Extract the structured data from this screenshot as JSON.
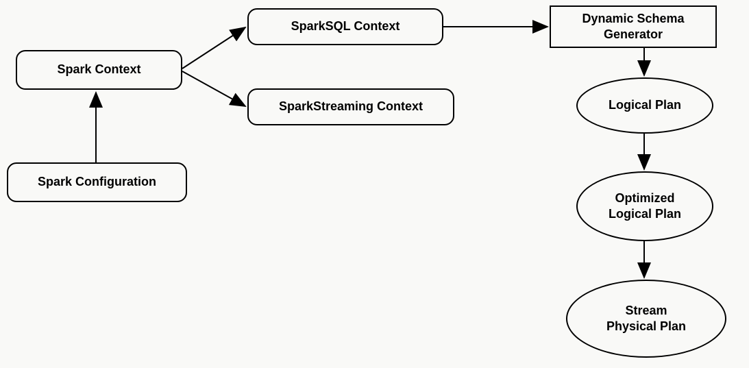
{
  "nodes": {
    "sparkContext": "Spark Context",
    "sparkConfiguration": "Spark Configuration",
    "sparksqlContext": "SparkSQL Context",
    "sparkstreamingContext": "SparkStreaming Context",
    "dynamicSchemaGenerator": "Dynamic Schema\nGenerator",
    "logicalPlan": "Logical Plan",
    "optimizedLogicalPlan": "Optimized\nLogical Plan",
    "streamPhysicalPlan": "Stream\nPhysical Plan"
  }
}
